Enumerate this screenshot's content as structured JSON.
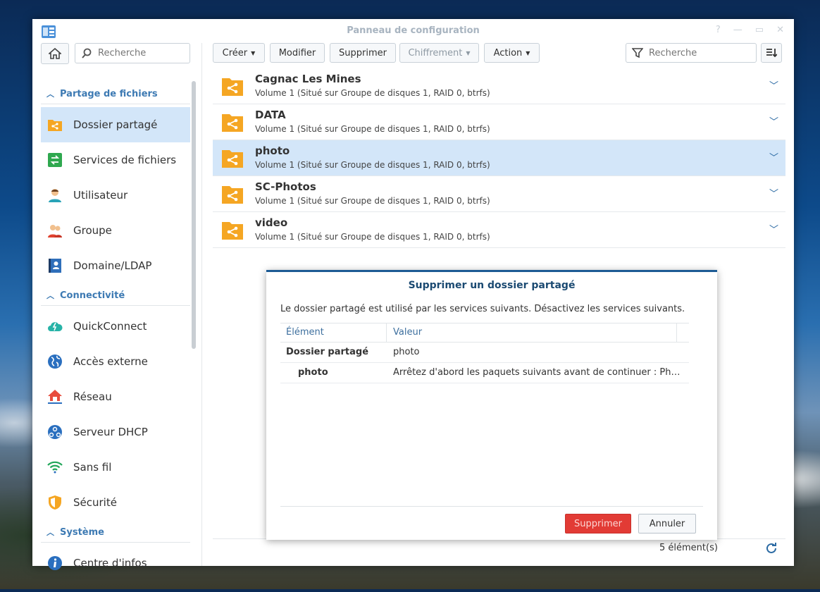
{
  "window": {
    "title": "Panneau de configuration",
    "controls": {
      "help": "?",
      "minimize": "—",
      "maximize": "▭",
      "close": "✕"
    }
  },
  "left": {
    "search_placeholder": "Recherche",
    "sections": [
      {
        "label": "Partage de fichiers"
      },
      {
        "label": "Connectivité"
      },
      {
        "label": "Système"
      }
    ],
    "items": [
      {
        "label": "Dossier partagé"
      },
      {
        "label": "Services de fichiers"
      },
      {
        "label": "Utilisateur"
      },
      {
        "label": "Groupe"
      },
      {
        "label": "Domaine/LDAP"
      },
      {
        "label": "QuickConnect"
      },
      {
        "label": "Accès externe"
      },
      {
        "label": "Réseau"
      },
      {
        "label": "Serveur DHCP"
      },
      {
        "label": "Sans fil"
      },
      {
        "label": "Sécurité"
      },
      {
        "label": "Centre d'infos"
      }
    ]
  },
  "toolbar": {
    "create": "Créer",
    "modify": "Modifier",
    "delete": "Supprimer",
    "encryption": "Chiffrement",
    "action": "Action",
    "search_placeholder": "Recherche"
  },
  "folders": [
    {
      "name": "Cagnac Les Mines",
      "desc": "Volume 1 (Situé sur Groupe de disques 1, RAID 0, btrfs)"
    },
    {
      "name": "DATA",
      "desc": "Volume 1 (Situé sur Groupe de disques 1, RAID 0, btrfs)"
    },
    {
      "name": "photo",
      "desc": "Volume 1 (Situé sur Groupe de disques 1, RAID 0, btrfs)"
    },
    {
      "name": "SC-Photos",
      "desc": "Volume 1 (Situé sur Groupe de disques 1, RAID 0, btrfs)"
    },
    {
      "name": "video",
      "desc": "Volume 1 (Situé sur Groupe de disques 1, RAID 0, btrfs)"
    }
  ],
  "footer": {
    "count": "5 élément(s)"
  },
  "dialog": {
    "title": "Supprimer un dossier partagé",
    "message": "Le dossier partagé est utilisé par les services suivants. Désactivez les services suivants.",
    "columns": {
      "element": "Élément",
      "value": "Valeur"
    },
    "rows": [
      {
        "element": "Dossier partagé",
        "value": "photo"
      },
      {
        "element": "photo",
        "value": "Arrêtez d'abord les paquets suivants avant de continuer : Photo S..."
      }
    ],
    "delete_label": "Supprimer",
    "cancel_label": "Annuler"
  },
  "colors": {
    "accent": "#3d7ab3",
    "selected_row": "#d3e6f9",
    "danger": "#e23b35",
    "folder_icon": "#f5a623"
  }
}
